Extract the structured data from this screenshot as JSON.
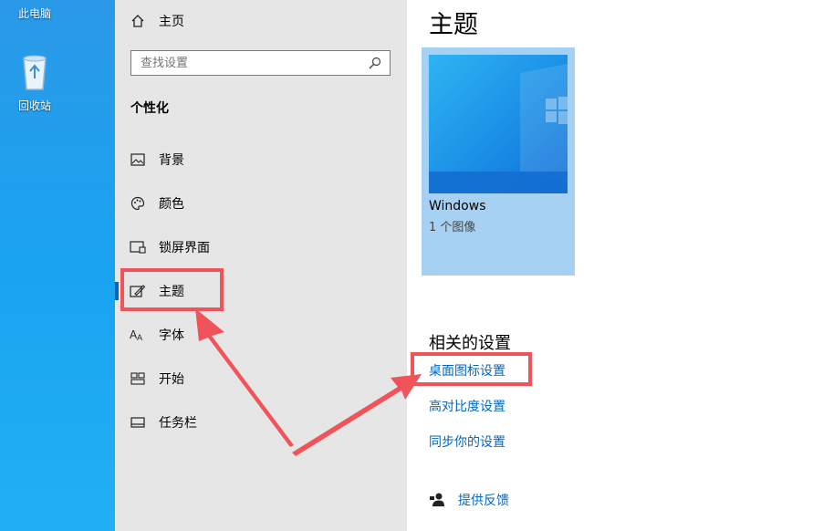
{
  "desktop": {
    "icons": [
      {
        "label": "此电脑",
        "glyph": "computer-icon"
      },
      {
        "label": "回收站",
        "glyph": "recycle-bin-icon"
      }
    ]
  },
  "sidebar": {
    "home_label": "主页",
    "search_placeholder": "查找设置",
    "section_title": "个性化",
    "items": [
      {
        "label": "背景",
        "icon": "image-icon"
      },
      {
        "label": "颜色",
        "icon": "palette-icon"
      },
      {
        "label": "锁屏界面",
        "icon": "lock-screen-icon"
      },
      {
        "label": "主题",
        "icon": "theme-brush-icon",
        "active": true
      },
      {
        "label": "字体",
        "icon": "font-icon"
      },
      {
        "label": "开始",
        "icon": "start-icon"
      },
      {
        "label": "任务栏",
        "icon": "taskbar-icon"
      }
    ]
  },
  "content": {
    "page_title": "主题",
    "theme": {
      "name": "Windows",
      "count": "1 个图像"
    },
    "related_title": "相关的设置",
    "links": [
      "桌面图标设置",
      "高对比度设置",
      "同步你的设置"
    ],
    "feedback_label": "提供反馈"
  },
  "colors": {
    "accent": "#0067c0",
    "annotation": "#f0535a",
    "sidebar_bg": "#e6e6e6",
    "theme_card": "#a6d1f2"
  }
}
